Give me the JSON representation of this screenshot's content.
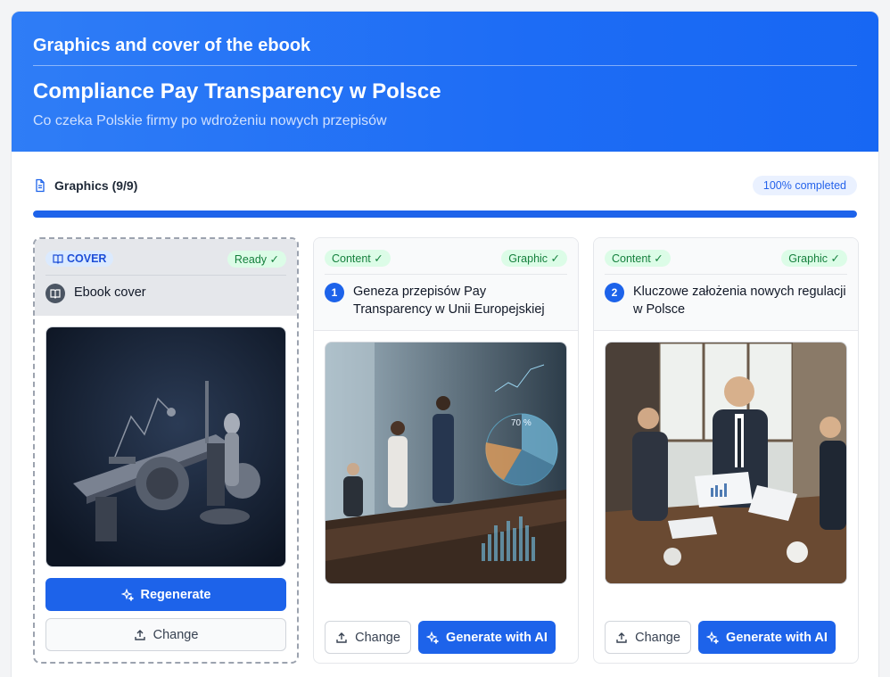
{
  "header": {
    "section_title": "Graphics and cover of the ebook",
    "ebook_title": "Compliance Pay Transparency w Polsce",
    "ebook_subtitle": "Co czeka Polskie firmy po wdrożeniu nowych przepisów"
  },
  "progress": {
    "label": "Graphics (9/9)",
    "badge": "100% completed",
    "value": 1.0
  },
  "colors": {
    "accent": "#1d63ea",
    "header_from": "#2f7df6",
    "header_to": "#1767f3",
    "success": "#15803d"
  },
  "cover_card": {
    "tag": "COVER",
    "status": "Ready ✓",
    "title": "Ebook cover",
    "regenerate_label": "Regenerate",
    "change_label": "Change",
    "icon": "book-icon"
  },
  "cards": [
    {
      "number": "1",
      "content_tag": "Content ✓",
      "graphic_tag": "Graphic ✓",
      "title": "Geneza przepisów Pay Transparency w Unii Europejskiej",
      "change_label": "Change",
      "generate_label": "Generate with AI",
      "chart_overlay_text": "70 %"
    },
    {
      "number": "2",
      "content_tag": "Content ✓",
      "graphic_tag": "Graphic ✓",
      "title": "Kluczowe założenia nowych regulacji w Polsce",
      "change_label": "Change",
      "generate_label": "Generate with AI"
    }
  ]
}
